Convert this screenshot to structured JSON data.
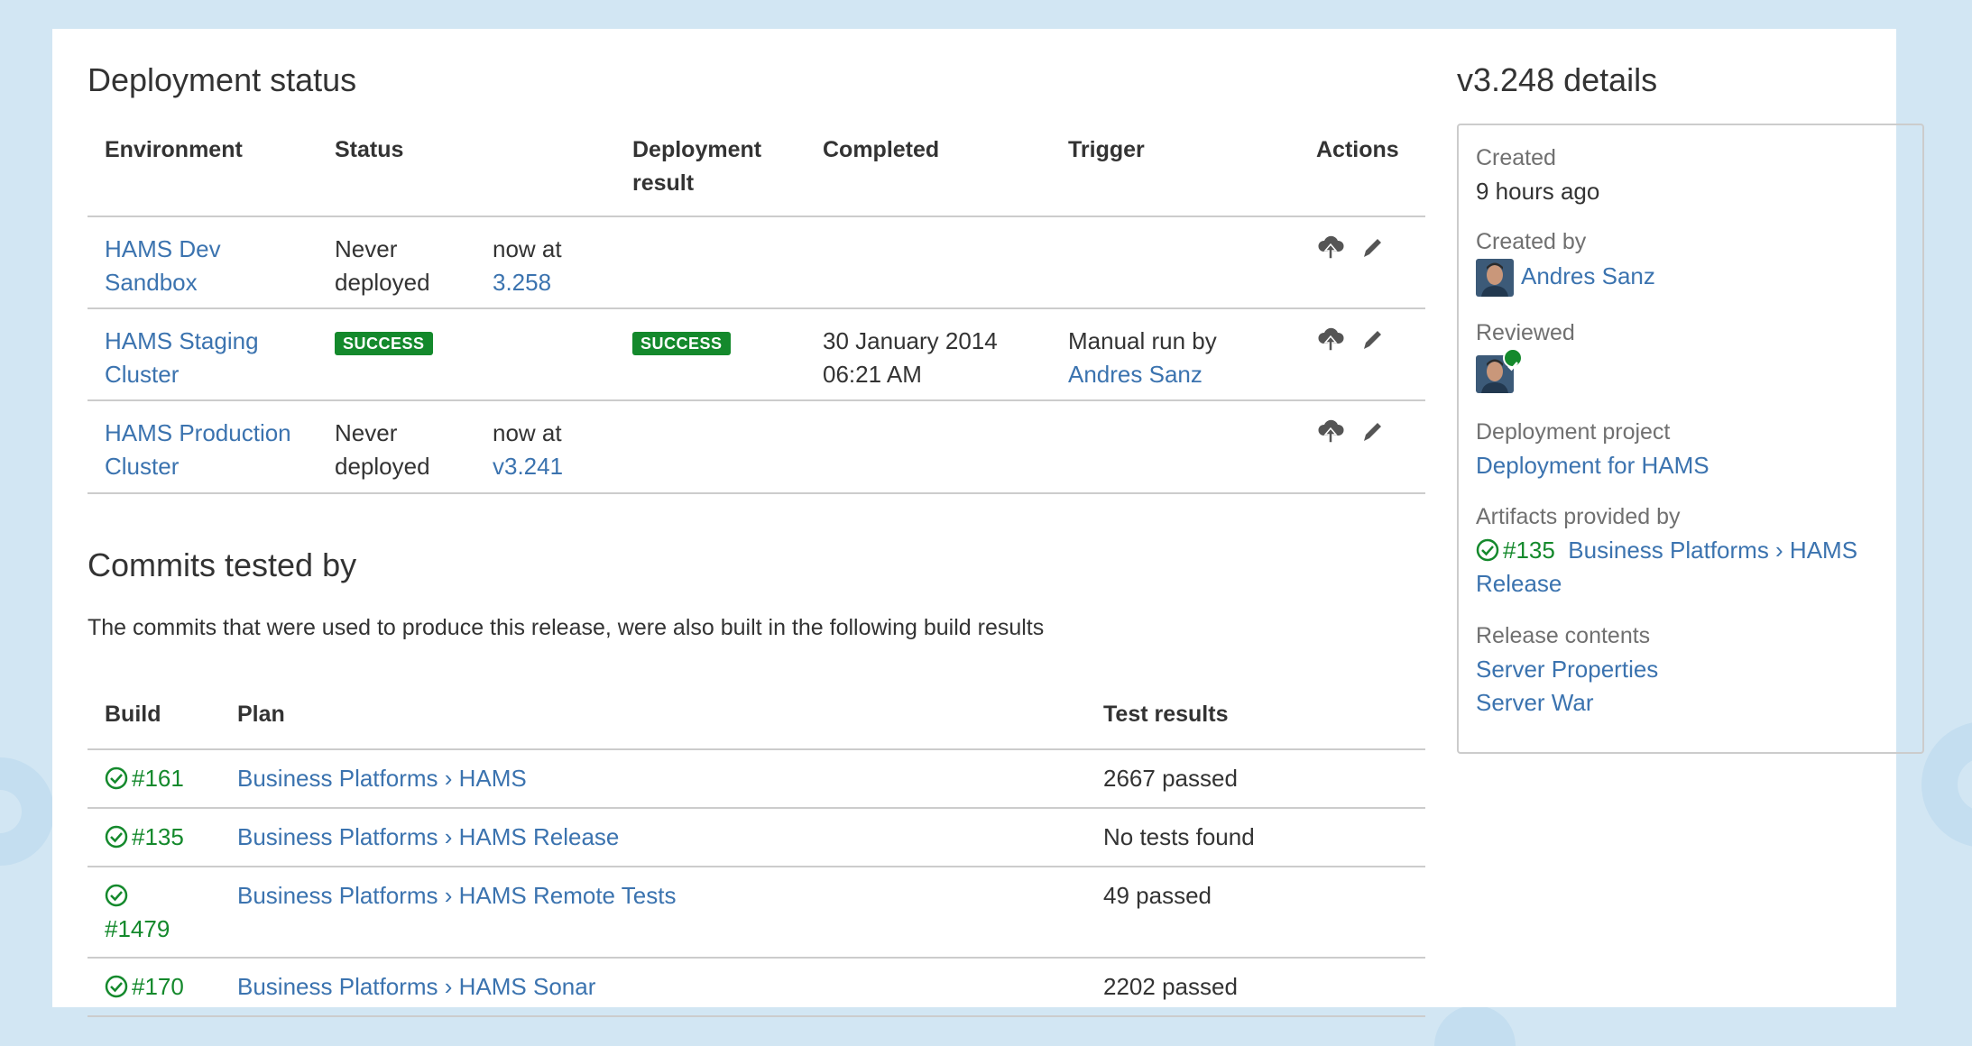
{
  "deployment": {
    "heading": "Deployment status",
    "columns": [
      "Environment",
      "Status",
      "Deployment result",
      "Completed",
      "Trigger",
      "Actions"
    ],
    "rows": [
      {
        "env": "HAMS Dev Sandbox",
        "status": "Never deployed",
        "version_prefix": "now at",
        "version": "3.258",
        "result": "",
        "completed": "",
        "trigger_text": "",
        "trigger_user": ""
      },
      {
        "env": "HAMS Staging Cluster",
        "status_badge": "SUCCESS",
        "result_badge": "SUCCESS",
        "completed": "30 January 2014 06:21 AM",
        "trigger_text": "Manual run by",
        "trigger_user": "Andres Sanz"
      },
      {
        "env": "HAMS Production Cluster",
        "status": "Never deployed",
        "version_prefix": "now at",
        "version": "v3.241",
        "result": "",
        "completed": "",
        "trigger_text": "",
        "trigger_user": ""
      }
    ],
    "actions": {
      "deploy_icon": "cloud-upload-icon",
      "edit_icon": "pencil-icon"
    }
  },
  "commits": {
    "heading": "Commits tested by",
    "description": "The commits that were used to produce this release, were also built in the following build results",
    "columns": [
      "Build",
      "Plan",
      "Test results"
    ],
    "rows": [
      {
        "build": "#161",
        "plan": "Business Platforms › HAMS",
        "tests": "2667 passed"
      },
      {
        "build": "#135",
        "plan": "Business Platforms › HAMS Release",
        "tests": "No tests found"
      },
      {
        "build": "#1479",
        "plan": "Business Platforms › HAMS Remote Tests",
        "tests": "49 passed"
      },
      {
        "build": "#170",
        "plan": "Business Platforms › HAMS Sonar",
        "tests": "2202 passed"
      }
    ]
  },
  "details": {
    "heading": "v3.248 details",
    "created_label": "Created",
    "created_value": "9 hours ago",
    "created_by_label": "Created by",
    "created_by_user": "Andres Sanz",
    "reviewed_label": "Reviewed",
    "project_label": "Deployment project",
    "project_value": "Deployment for HAMS",
    "artifacts_label": "Artifacts provided by",
    "artifacts_build": "#135",
    "artifacts_plan": "Business Platforms › HAMS Release",
    "contents_label": "Release contents",
    "contents": [
      "Server Properties",
      "Server War"
    ]
  },
  "colors": {
    "link": "#3b73af",
    "success": "#14892c",
    "background": "#d2e6f3"
  }
}
